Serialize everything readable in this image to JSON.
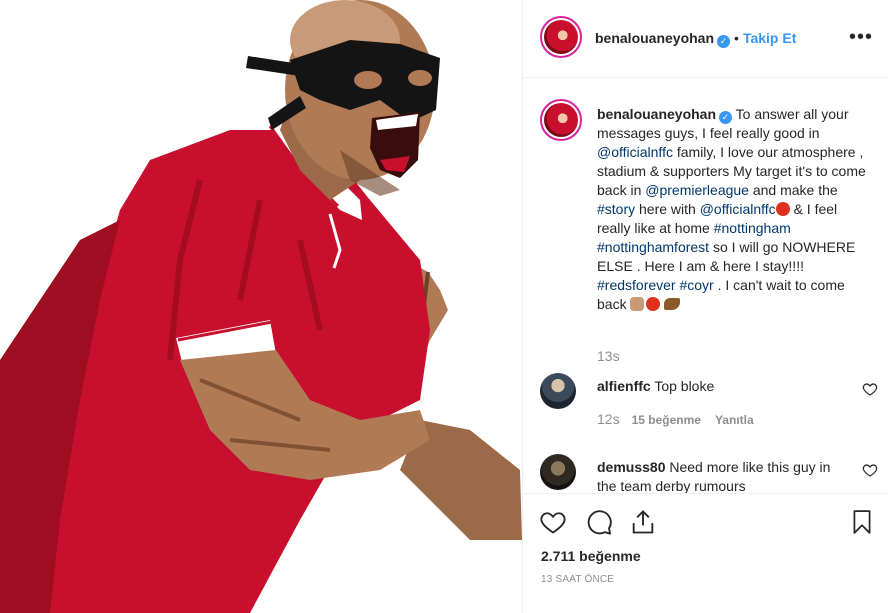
{
  "post": {
    "username": "benalouaneyohan",
    "separator": "•",
    "follow_label": "Takip Et",
    "more_icon": "more-options-icon"
  },
  "caption": {
    "username": "benalouaneyohan",
    "part1": " To answer all your messages guys, I feel really good in ",
    "mention1": "@officialnffc",
    "part2": " family, I love our atmosphere , stadium & supporters My target it's to come back in ",
    "mention2": "@premierleague",
    "part3": " and make the ",
    "tag_story": "#story",
    "part4": " here with ",
    "mention3": "@officialnffc",
    "part5": " & I feel really like at home ",
    "tag_nottingham": "#nottingham",
    "part6": " ",
    "tag_forest": "#nottinghamforest",
    "part7": " so I will go NOWHERE ELSE . Here I am & here I stay!!!! ",
    "tag_reds": "#redsforever",
    "part8": " ",
    "tag_coyr": "#coyr",
    "part9": " . I can't wait to come back ",
    "time": "13s"
  },
  "comments": [
    {
      "username": "alfienffc",
      "text": " Top bloke",
      "time": "12s",
      "likes": "15 beğenme",
      "reply": "Yanıtla"
    },
    {
      "username": "demuss80",
      "text": " Need more like this guy in the team derby rumours"
    }
  ],
  "footer": {
    "likes": "2.711 beğenme",
    "ago": "13 SAAT ÖNCE"
  },
  "colors": {
    "link": "#00376b",
    "accent": "#3897f0",
    "meta": "#8e8e8e",
    "jersey": "#c8102e"
  }
}
